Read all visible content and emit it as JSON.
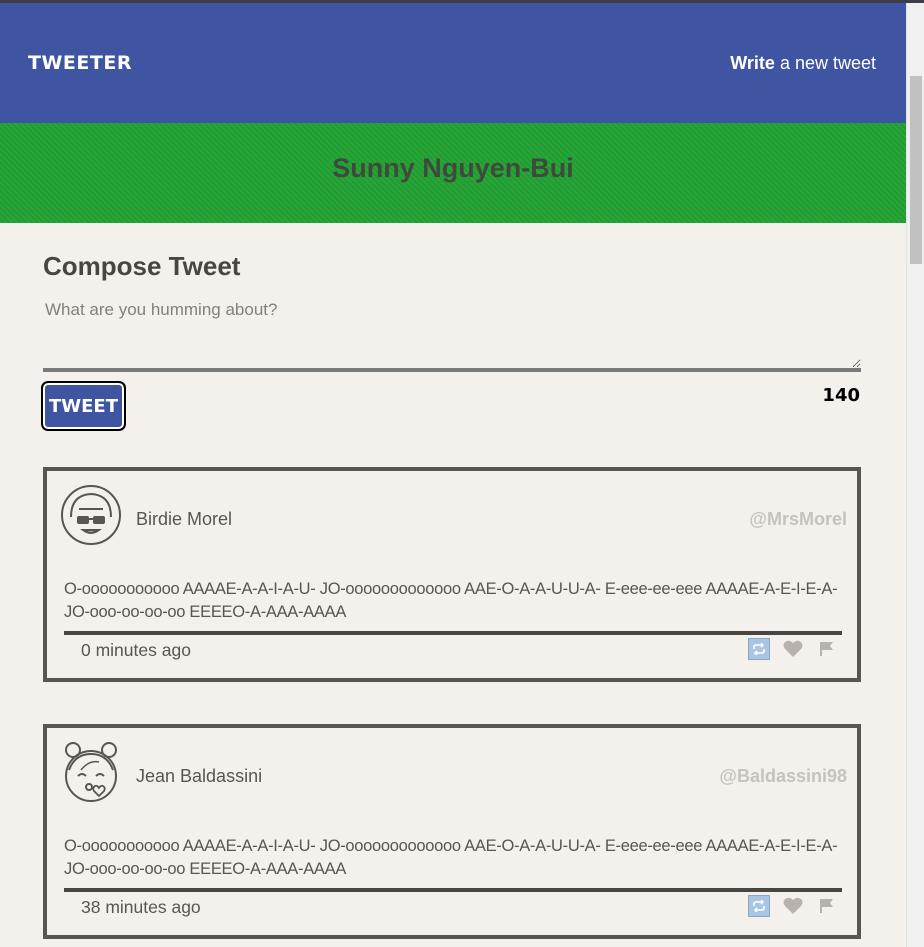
{
  "nav": {
    "brand": "TWEETER",
    "compose_strong": "Write",
    "compose_rest": " a new tweet"
  },
  "banner": {
    "name": "Sunny Nguyen-Bui"
  },
  "compose": {
    "title": "Compose Tweet",
    "placeholder": "What are you humming about?",
    "button_label": "TWEET",
    "counter": "140"
  },
  "tweets": [
    {
      "name": "Birdie Morel",
      "handle": "@MrsMorel",
      "text": "O-ooooooooooo AAAAE-A-A-I-A-U- JO-ooooooooooooo AAE-O-A-A-U-U-A- E-eee-ee-eee AAAAE-A-E-I-E-A- JO-ooo-oo-oo-oo EEEEO-A-AAA-AAAA",
      "time": "0 minutes ago",
      "avatar_icon": "avatar-girl-sunglasses-icon"
    },
    {
      "name": "Jean Baldassini",
      "handle": "@Baldassini98",
      "text": "O-ooooooooooo AAAAE-A-A-I-A-U- JO-ooooooooooooo AAE-O-A-A-U-U-A- E-eee-ee-eee AAAAE-A-E-I-E-A- JO-ooo-oo-oo-oo EEEEO-A-AAA-AAAA",
      "time": "38 minutes ago",
      "avatar_icon": "avatar-girl-kiss-icon"
    }
  ],
  "colors": {
    "nav": "#3f55a2",
    "banner": "#21a132",
    "background": "#f4f1ec",
    "retweet_highlight": "#a8c6e4"
  }
}
